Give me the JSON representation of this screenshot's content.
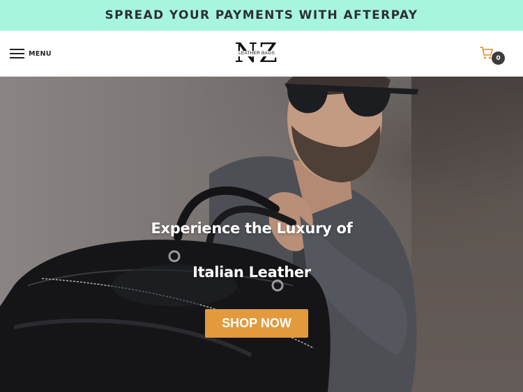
{
  "promo": {
    "text": "SPREAD YOUR PAYMENTS WITH AFTERPAY",
    "background": "#a8f5df"
  },
  "header": {
    "menu_label": "MENU",
    "menu_icon": "hamburger-icon",
    "logo": {
      "letters": "NZ",
      "subtitle": "LEATHER BAGS"
    },
    "cart": {
      "icon": "shopping-cart-icon",
      "count": "0",
      "icon_color": "#e29a3c"
    }
  },
  "hero": {
    "heading_line1": "Experience the Luxury of",
    "heading_line2": "Italian Leather",
    "cta_label": "SHOP NOW",
    "cta_color": "#e29a3c"
  }
}
